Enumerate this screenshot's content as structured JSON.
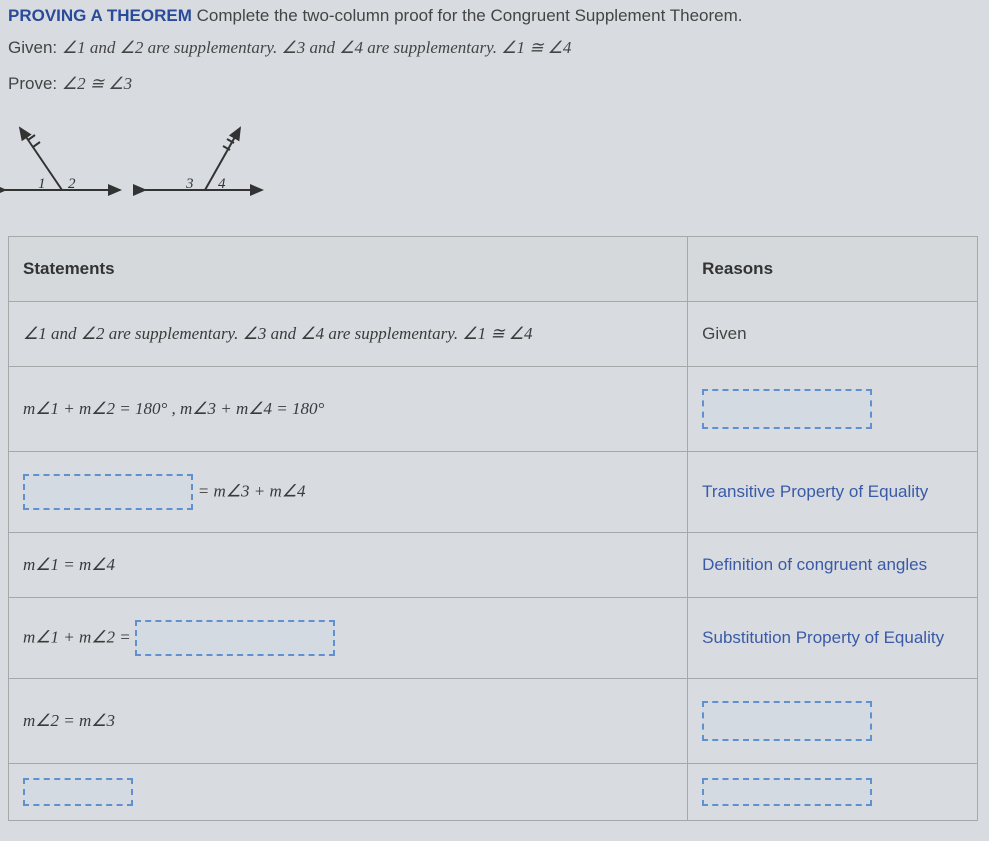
{
  "header": {
    "title": "PROVING A THEOREM",
    "instruction": "Complete the two-column proof for the Congruent Supplement Theorem."
  },
  "given": {
    "label": "Given:",
    "text": "∠1  and  ∠2  are supplementary.  ∠3  and  ∠4  are supplementary.  ∠1 ≅ ∠4"
  },
  "prove": {
    "label": "Prove:",
    "text": "∠2 ≅ ∠3"
  },
  "diagram": {
    "labels": [
      "1",
      "2",
      "3",
      "4"
    ]
  },
  "table": {
    "headers": {
      "statements": "Statements",
      "reasons": "Reasons"
    },
    "rows": [
      {
        "statement": "∠1  and  ∠2  are supplementary.  ∠3  and  ∠4  are supplementary.  ∠1 ≅ ∠4",
        "reason": "Given"
      },
      {
        "statement": "m∠1 + m∠2 = 180° ,  m∠3 + m∠4 = 180°",
        "reason": ""
      },
      {
        "statement_suffix": " = m∠3 + m∠4",
        "reason": "Transitive Property of Equality"
      },
      {
        "statement": "m∠1 = m∠4",
        "reason": "Definition of congruent angles"
      },
      {
        "statement_prefix": "m∠1 + m∠2 = ",
        "reason": "Substitution Property of Equality"
      },
      {
        "statement": "m∠2 = m∠3",
        "reason": ""
      }
    ]
  }
}
